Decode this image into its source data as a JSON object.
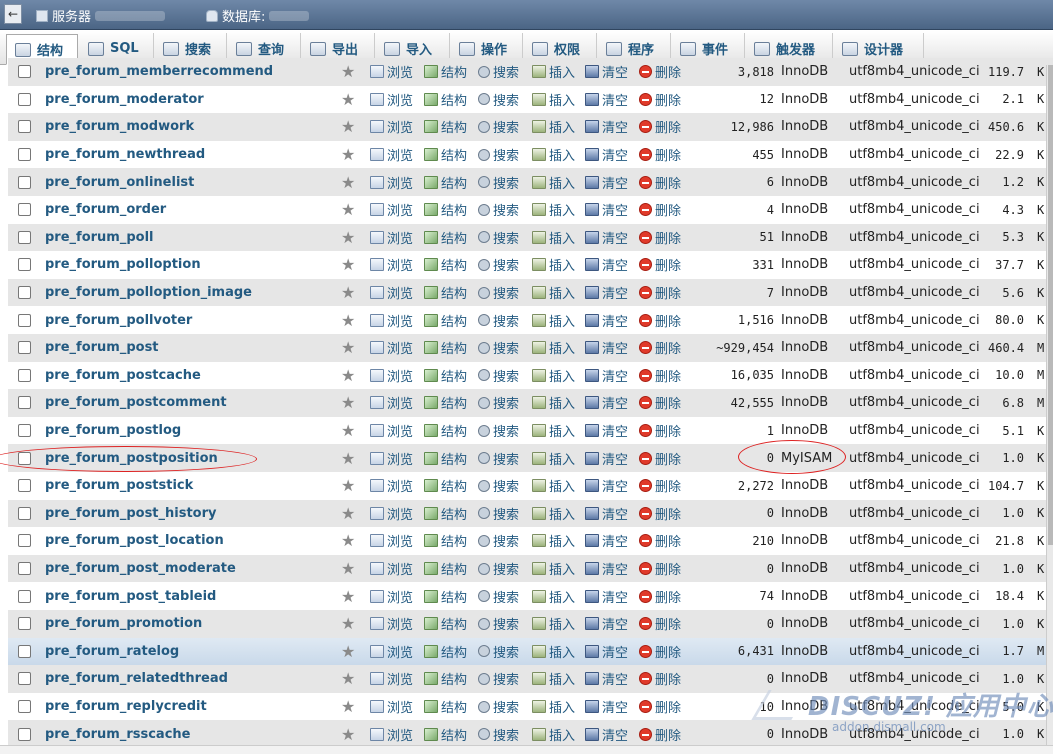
{
  "breadcrumb": {
    "back": "←",
    "server_label": "服务器",
    "database_label": "数据库:"
  },
  "tabs": [
    {
      "label": "结构",
      "icon": "structure-icon"
    },
    {
      "label": "SQL",
      "icon": "sql-icon"
    },
    {
      "label": "搜索",
      "icon": "search-icon"
    },
    {
      "label": "查询",
      "icon": "query-icon"
    },
    {
      "label": "导出",
      "icon": "export-icon"
    },
    {
      "label": "导入",
      "icon": "import-icon"
    },
    {
      "label": "操作",
      "icon": "wrench-icon"
    },
    {
      "label": "权限",
      "icon": "privileges-icon"
    },
    {
      "label": "程序",
      "icon": "routines-icon"
    },
    {
      "label": "事件",
      "icon": "clock-icon"
    },
    {
      "label": "触发器",
      "icon": "triggers-icon"
    },
    {
      "label": "设计器",
      "icon": "designer-icon"
    }
  ],
  "actions": {
    "browse": "浏览",
    "structure": "结构",
    "search": "搜索",
    "insert": "插入",
    "empty": "清空",
    "drop": "删除"
  },
  "rows": [
    {
      "name": "pre_forum_memberrecommend",
      "rows": "3,818",
      "engine": "InnoDB",
      "collation": "utf8mb4_unicode_ci",
      "size": "119.7",
      "unit": "K"
    },
    {
      "name": "pre_forum_moderator",
      "rows": "12",
      "engine": "InnoDB",
      "collation": "utf8mb4_unicode_ci",
      "size": "2.1",
      "unit": "K"
    },
    {
      "name": "pre_forum_modwork",
      "rows": "12,986",
      "engine": "InnoDB",
      "collation": "utf8mb4_unicode_ci",
      "size": "450.6",
      "unit": "K"
    },
    {
      "name": "pre_forum_newthread",
      "rows": "455",
      "engine": "InnoDB",
      "collation": "utf8mb4_unicode_ci",
      "size": "22.9",
      "unit": "K"
    },
    {
      "name": "pre_forum_onlinelist",
      "rows": "6",
      "engine": "InnoDB",
      "collation": "utf8mb4_unicode_ci",
      "size": "1.2",
      "unit": "K"
    },
    {
      "name": "pre_forum_order",
      "rows": "4",
      "engine": "InnoDB",
      "collation": "utf8mb4_unicode_ci",
      "size": "4.3",
      "unit": "K"
    },
    {
      "name": "pre_forum_poll",
      "rows": "51",
      "engine": "InnoDB",
      "collation": "utf8mb4_unicode_ci",
      "size": "5.3",
      "unit": "K"
    },
    {
      "name": "pre_forum_polloption",
      "rows": "331",
      "engine": "InnoDB",
      "collation": "utf8mb4_unicode_ci",
      "size": "37.7",
      "unit": "K"
    },
    {
      "name": "pre_forum_polloption_image",
      "rows": "7",
      "engine": "InnoDB",
      "collation": "utf8mb4_unicode_ci",
      "size": "5.6",
      "unit": "K"
    },
    {
      "name": "pre_forum_pollvoter",
      "rows": "1,516",
      "engine": "InnoDB",
      "collation": "utf8mb4_unicode_ci",
      "size": "80.0",
      "unit": "K"
    },
    {
      "name": "pre_forum_post",
      "rows": "~929,454",
      "engine": "InnoDB",
      "collation": "utf8mb4_unicode_ci",
      "size": "460.4",
      "unit": "M"
    },
    {
      "name": "pre_forum_postcache",
      "rows": "16,035",
      "engine": "InnoDB",
      "collation": "utf8mb4_unicode_ci",
      "size": "10.0",
      "unit": "M"
    },
    {
      "name": "pre_forum_postcomment",
      "rows": "42,555",
      "engine": "InnoDB",
      "collation": "utf8mb4_unicode_ci",
      "size": "6.8",
      "unit": "M"
    },
    {
      "name": "pre_forum_postlog",
      "rows": "1",
      "engine": "InnoDB",
      "collation": "utf8mb4_unicode_ci",
      "size": "5.1",
      "unit": "K"
    },
    {
      "name": "pre_forum_postposition",
      "rows": "0",
      "engine": "MyISAM",
      "collation": "utf8mb4_unicode_ci",
      "size": "1.0",
      "unit": "K"
    },
    {
      "name": "pre_forum_poststick",
      "rows": "2,272",
      "engine": "InnoDB",
      "collation": "utf8mb4_unicode_ci",
      "size": "104.7",
      "unit": "K"
    },
    {
      "name": "pre_forum_post_history",
      "rows": "0",
      "engine": "InnoDB",
      "collation": "utf8mb4_unicode_ci",
      "size": "1.0",
      "unit": "K"
    },
    {
      "name": "pre_forum_post_location",
      "rows": "210",
      "engine": "InnoDB",
      "collation": "utf8mb4_unicode_ci",
      "size": "21.8",
      "unit": "K"
    },
    {
      "name": "pre_forum_post_moderate",
      "rows": "0",
      "engine": "InnoDB",
      "collation": "utf8mb4_unicode_ci",
      "size": "1.0",
      "unit": "K"
    },
    {
      "name": "pre_forum_post_tableid",
      "rows": "74",
      "engine": "InnoDB",
      "collation": "utf8mb4_unicode_ci",
      "size": "18.4",
      "unit": "K"
    },
    {
      "name": "pre_forum_promotion",
      "rows": "0",
      "engine": "InnoDB",
      "collation": "utf8mb4_unicode_ci",
      "size": "1.0",
      "unit": "K"
    },
    {
      "name": "pre_forum_ratelog",
      "rows": "6,431",
      "engine": "InnoDB",
      "collation": "utf8mb4_unicode_ci",
      "size": "1.7",
      "unit": "M"
    },
    {
      "name": "pre_forum_relatedthread",
      "rows": "0",
      "engine": "InnoDB",
      "collation": "utf8mb4_unicode_ci",
      "size": "1.0",
      "unit": "K"
    },
    {
      "name": "pre_forum_replycredit",
      "rows": "10",
      "engine": "InnoDB",
      "collation": "utf8mb4_unicode_ci",
      "size": "5.0",
      "unit": "K"
    },
    {
      "name": "pre_forum_rsscache",
      "rows": "0",
      "engine": "InnoDB",
      "collation": "utf8mb4_unicode_ci",
      "size": "1.0",
      "unit": "K"
    }
  ],
  "watermark": {
    "logo": "DISCUZ! 应用中心",
    "url": "addon.dismall.com"
  },
  "colors": {
    "link": "#235a81",
    "odd_row": "#e6e6e6",
    "highlight_row": "#c9d9ea",
    "annotation": "#dd2222"
  }
}
